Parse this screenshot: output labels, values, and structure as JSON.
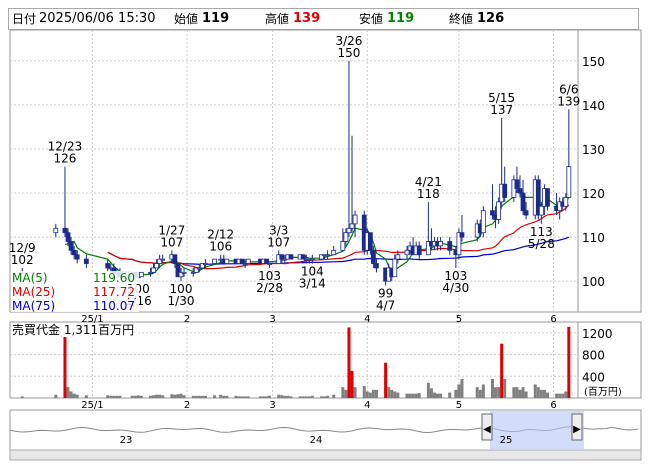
{
  "header": {
    "date_label": "日付",
    "date": "2025/06/06 15:30",
    "open_label": "始値",
    "open": "119",
    "high_label": "高値",
    "high": "139",
    "low_label": "安値",
    "low": "119",
    "close_label": "終値",
    "close": "126"
  },
  "legend": [
    {
      "label": "MA(5)",
      "value": "119.60",
      "color": "#008000"
    },
    {
      "label": "MA(25)",
      "value": "117.72",
      "color": "#e00000"
    },
    {
      "label": "MA(75)",
      "value": "110.07",
      "color": "#0000d0"
    }
  ],
  "volume_label": "売買代金 1,311百万円",
  "volume_unit": "(百万円)",
  "nav_labels": [
    "23",
    "24",
    "25"
  ],
  "colors": {
    "up": "#ffffff",
    "down": "#1a2b8c",
    "ma5": "#008000",
    "ma25": "#e00000",
    "ma75": "#0000d0",
    "vol": "#808080",
    "vol_hi": "#e00000"
  },
  "chart_data": {
    "type": "candlestick",
    "y_ticks": [
      100,
      110,
      120,
      130,
      140,
      150
    ],
    "ylim": [
      93,
      157
    ],
    "vol_ticks": [
      400,
      800,
      1200
    ],
    "vol_lim": [
      0,
      1400
    ],
    "month_labels": [
      {
        "label": "25/1",
        "date": "2025-01-01"
      },
      {
        "label": "2",
        "date": "2025-02-01"
      },
      {
        "label": "3",
        "date": "2025-03-01"
      },
      {
        "label": "4",
        "date": "2025-04-01"
      },
      {
        "label": "5",
        "date": "2025-05-01"
      },
      {
        "label": "6",
        "date": "2025-06-01"
      }
    ],
    "annotations": [
      {
        "date": "2024-12-09",
        "text": "12/9",
        "value": "102",
        "pos": "above"
      },
      {
        "date": "2024-12-23",
        "text": "12/23",
        "value": "126",
        "pos": "above"
      },
      {
        "date": "2025-01-16",
        "text": "1/16",
        "value": "100",
        "pos": "below"
      },
      {
        "date": "2025-01-27",
        "text": "1/27",
        "value": "107",
        "pos": "above"
      },
      {
        "date": "2025-01-30",
        "text": "1/30",
        "value": "100",
        "pos": "below"
      },
      {
        "date": "2025-02-12",
        "text": "2/12",
        "value": "106",
        "pos": "above"
      },
      {
        "date": "2025-02-28",
        "text": "2/28",
        "value": "103",
        "pos": "below"
      },
      {
        "date": "2025-03-03",
        "text": "3/3",
        "value": "107",
        "pos": "above"
      },
      {
        "date": "2025-03-14",
        "text": "3/14",
        "value": "104",
        "pos": "below"
      },
      {
        "date": "2025-03-26",
        "text": "3/26",
        "value": "150",
        "pos": "above"
      },
      {
        "date": "2025-04-07",
        "text": "4/7",
        "value": "99",
        "pos": "below"
      },
      {
        "date": "2025-04-21",
        "text": "4/21",
        "value": "118",
        "pos": "above"
      },
      {
        "date": "2025-04-30",
        "text": "4/30",
        "value": "103",
        "pos": "below"
      },
      {
        "date": "2025-05-15",
        "text": "5/15",
        "value": "137",
        "pos": "above"
      },
      {
        "date": "2025-05-28",
        "text": "5/28",
        "value": "113",
        "pos": "below"
      },
      {
        "date": "2025-06-06",
        "text": "6/6",
        "value": "139",
        "pos": "above"
      }
    ],
    "candles": [
      {
        "d": "2024-12-09",
        "o": 102,
        "h": 103,
        "l": 102,
        "c": 102,
        "v": 30
      },
      {
        "d": "2024-12-20",
        "o": 111,
        "h": 113,
        "l": 110,
        "c": 112,
        "v": 60
      },
      {
        "d": "2024-12-23",
        "o": 112,
        "h": 126,
        "l": 110,
        "c": 111,
        "v": 1250
      },
      {
        "d": "2024-12-24",
        "o": 111,
        "h": 112,
        "l": 108,
        "c": 109,
        "v": 200
      },
      {
        "d": "2024-12-25",
        "o": 109,
        "h": 110,
        "l": 106,
        "c": 107,
        "v": 120
      },
      {
        "d": "2024-12-26",
        "o": 107,
        "h": 108,
        "l": 105,
        "c": 106,
        "v": 80
      },
      {
        "d": "2024-12-27",
        "o": 106,
        "h": 107,
        "l": 104,
        "c": 105,
        "v": 60
      },
      {
        "d": "2024-12-30",
        "o": 105,
        "h": 106,
        "l": 103,
        "c": 104,
        "v": 50
      },
      {
        "d": "2025-01-06",
        "o": 104,
        "h": 105,
        "l": 102,
        "c": 103,
        "v": 50
      },
      {
        "d": "2025-01-07",
        "o": 103,
        "h": 104,
        "l": 102,
        "c": 103,
        "v": 40
      },
      {
        "d": "2025-01-08",
        "o": 103,
        "h": 104,
        "l": 102,
        "c": 102,
        "v": 40
      },
      {
        "d": "2025-01-09",
        "o": 102,
        "h": 103,
        "l": 101,
        "c": 102,
        "v": 40
      },
      {
        "d": "2025-01-10",
        "o": 102,
        "h": 103,
        "l": 101,
        "c": 101,
        "v": 40
      },
      {
        "d": "2025-01-14",
        "o": 101,
        "h": 102,
        "l": 101,
        "c": 102,
        "v": 40
      },
      {
        "d": "2025-01-15",
        "o": 102,
        "h": 102,
        "l": 100,
        "c": 101,
        "v": 40
      },
      {
        "d": "2025-01-16",
        "o": 101,
        "h": 102,
        "l": 100,
        "c": 101,
        "v": 50
      },
      {
        "d": "2025-01-17",
        "o": 101,
        "h": 102,
        "l": 101,
        "c": 102,
        "v": 40
      },
      {
        "d": "2025-01-20",
        "o": 102,
        "h": 103,
        "l": 101,
        "c": 102,
        "v": 40
      },
      {
        "d": "2025-01-21",
        "o": 102,
        "h": 104,
        "l": 102,
        "c": 103,
        "v": 50
      },
      {
        "d": "2025-01-22",
        "o": 103,
        "h": 105,
        "l": 103,
        "c": 104,
        "v": 60
      },
      {
        "d": "2025-01-23",
        "o": 104,
        "h": 106,
        "l": 103,
        "c": 105,
        "v": 60
      },
      {
        "d": "2025-01-24",
        "o": 105,
        "h": 106,
        "l": 104,
        "c": 105,
        "v": 50
      },
      {
        "d": "2025-01-27",
        "o": 105,
        "h": 107,
        "l": 104,
        "c": 106,
        "v": 70
      },
      {
        "d": "2025-01-28",
        "o": 106,
        "h": 106,
        "l": 103,
        "c": 104,
        "v": 60
      },
      {
        "d": "2025-01-29",
        "o": 104,
        "h": 104,
        "l": 101,
        "c": 101,
        "v": 70
      },
      {
        "d": "2025-01-30",
        "o": 101,
        "h": 103,
        "l": 100,
        "c": 102,
        "v": 80
      },
      {
        "d": "2025-01-31",
        "o": 102,
        "h": 103,
        "l": 101,
        "c": 102,
        "v": 50
      },
      {
        "d": "2025-02-03",
        "o": 102,
        "h": 103,
        "l": 101,
        "c": 102,
        "v": 40
      },
      {
        "d": "2025-02-04",
        "o": 102,
        "h": 103,
        "l": 102,
        "c": 103,
        "v": 40
      },
      {
        "d": "2025-02-05",
        "o": 103,
        "h": 104,
        "l": 102,
        "c": 103,
        "v": 40
      },
      {
        "d": "2025-02-06",
        "o": 103,
        "h": 104,
        "l": 103,
        "c": 104,
        "v": 40
      },
      {
        "d": "2025-02-07",
        "o": 104,
        "h": 105,
        "l": 103,
        "c": 104,
        "v": 40
      },
      {
        "d": "2025-02-10",
        "o": 104,
        "h": 105,
        "l": 104,
        "c": 105,
        "v": 50
      },
      {
        "d": "2025-02-12",
        "o": 105,
        "h": 106,
        "l": 104,
        "c": 105,
        "v": 60
      },
      {
        "d": "2025-02-13",
        "o": 105,
        "h": 106,
        "l": 104,
        "c": 104,
        "v": 40
      },
      {
        "d": "2025-02-14",
        "o": 104,
        "h": 105,
        "l": 104,
        "c": 105,
        "v": 40
      },
      {
        "d": "2025-02-17",
        "o": 105,
        "h": 105,
        "l": 104,
        "c": 104,
        "v": 40
      },
      {
        "d": "2025-02-18",
        "o": 104,
        "h": 105,
        "l": 104,
        "c": 105,
        "v": 30
      },
      {
        "d": "2025-02-19",
        "o": 105,
        "h": 105,
        "l": 104,
        "c": 104,
        "v": 30
      },
      {
        "d": "2025-02-20",
        "o": 104,
        "h": 105,
        "l": 103,
        "c": 104,
        "v": 30
      },
      {
        "d": "2025-02-21",
        "o": 104,
        "h": 105,
        "l": 104,
        "c": 105,
        "v": 30
      },
      {
        "d": "2025-02-25",
        "o": 105,
        "h": 105,
        "l": 104,
        "c": 104,
        "v": 30
      },
      {
        "d": "2025-02-26",
        "o": 104,
        "h": 105,
        "l": 104,
        "c": 105,
        "v": 30
      },
      {
        "d": "2025-02-27",
        "o": 105,
        "h": 105,
        "l": 104,
        "c": 104,
        "v": 30
      },
      {
        "d": "2025-02-28",
        "o": 104,
        "h": 104,
        "l": 103,
        "c": 104,
        "v": 40
      },
      {
        "d": "2025-03-03",
        "o": 104,
        "h": 107,
        "l": 104,
        "c": 106,
        "v": 60
      },
      {
        "d": "2025-03-04",
        "o": 106,
        "h": 106,
        "l": 104,
        "c": 105,
        "v": 50
      },
      {
        "d": "2025-03-05",
        "o": 105,
        "h": 106,
        "l": 104,
        "c": 105,
        "v": 40
      },
      {
        "d": "2025-03-06",
        "o": 105,
        "h": 106,
        "l": 105,
        "c": 106,
        "v": 40
      },
      {
        "d": "2025-03-07",
        "o": 106,
        "h": 106,
        "l": 105,
        "c": 105,
        "v": 30
      },
      {
        "d": "2025-03-10",
        "o": 105,
        "h": 106,
        "l": 105,
        "c": 106,
        "v": 30
      },
      {
        "d": "2025-03-11",
        "o": 106,
        "h": 106,
        "l": 105,
        "c": 105,
        "v": 30
      },
      {
        "d": "2025-03-12",
        "o": 105,
        "h": 106,
        "l": 104,
        "c": 105,
        "v": 30
      },
      {
        "d": "2025-03-13",
        "o": 105,
        "h": 105,
        "l": 104,
        "c": 105,
        "v": 30
      },
      {
        "d": "2025-03-14",
        "o": 105,
        "h": 106,
        "l": 104,
        "c": 105,
        "v": 40
      },
      {
        "d": "2025-03-17",
        "o": 105,
        "h": 106,
        "l": 105,
        "c": 106,
        "v": 30
      },
      {
        "d": "2025-03-18",
        "o": 106,
        "h": 106,
        "l": 105,
        "c": 106,
        "v": 30
      },
      {
        "d": "2025-03-19",
        "o": 106,
        "h": 107,
        "l": 105,
        "c": 106,
        "v": 40
      },
      {
        "d": "2025-03-21",
        "o": 106,
        "h": 108,
        "l": 106,
        "c": 107,
        "v": 60
      },
      {
        "d": "2025-03-24",
        "o": 107,
        "h": 112,
        "l": 107,
        "c": 109,
        "v": 200
      },
      {
        "d": "2025-03-25",
        "o": 109,
        "h": 112,
        "l": 108,
        "c": 111,
        "v": 150
      },
      {
        "d": "2025-03-26",
        "o": 111,
        "h": 150,
        "l": 110,
        "c": 112,
        "v": 1300
      },
      {
        "d": "2025-03-27",
        "o": 112,
        "h": 133,
        "l": 111,
        "c": 113,
        "v": 500
      },
      {
        "d": "2025-03-28",
        "o": 113,
        "h": 116,
        "l": 110,
        "c": 115,
        "v": 200
      },
      {
        "d": "2025-03-31",
        "o": 115,
        "h": 116,
        "l": 106,
        "c": 107,
        "v": 220
      },
      {
        "d": "2025-04-01",
        "o": 107,
        "h": 112,
        "l": 106,
        "c": 111,
        "v": 120
      },
      {
        "d": "2025-04-02",
        "o": 111,
        "h": 111,
        "l": 106,
        "c": 107,
        "v": 100
      },
      {
        "d": "2025-04-03",
        "o": 107,
        "h": 108,
        "l": 103,
        "c": 104,
        "v": 150
      },
      {
        "d": "2025-04-04",
        "o": 104,
        "h": 105,
        "l": 102,
        "c": 103,
        "v": 150
      },
      {
        "d": "2025-04-07",
        "o": 103,
        "h": 103,
        "l": 99,
        "c": 100,
        "v": 650
      },
      {
        "d": "2025-04-08",
        "o": 100,
        "h": 104,
        "l": 100,
        "c": 103,
        "v": 200
      },
      {
        "d": "2025-04-09",
        "o": 103,
        "h": 103,
        "l": 100,
        "c": 101,
        "v": 150
      },
      {
        "d": "2025-04-10",
        "o": 101,
        "h": 106,
        "l": 101,
        "c": 105,
        "v": 120
      },
      {
        "d": "2025-04-11",
        "o": 105,
        "h": 107,
        "l": 104,
        "c": 106,
        "v": 100
      },
      {
        "d": "2025-04-14",
        "o": 106,
        "h": 108,
        "l": 105,
        "c": 107,
        "v": 80
      },
      {
        "d": "2025-04-15",
        "o": 107,
        "h": 109,
        "l": 106,
        "c": 108,
        "v": 80
      },
      {
        "d": "2025-04-16",
        "o": 108,
        "h": 110,
        "l": 106,
        "c": 106,
        "v": 80
      },
      {
        "d": "2025-04-17",
        "o": 106,
        "h": 109,
        "l": 106,
        "c": 108,
        "v": 80
      },
      {
        "d": "2025-04-18",
        "o": 108,
        "h": 109,
        "l": 105,
        "c": 106,
        "v": 90
      },
      {
        "d": "2025-04-21",
        "o": 106,
        "h": 118,
        "l": 106,
        "c": 109,
        "v": 280
      },
      {
        "d": "2025-04-22",
        "o": 109,
        "h": 112,
        "l": 107,
        "c": 108,
        "v": 180
      },
      {
        "d": "2025-04-23",
        "o": 108,
        "h": 110,
        "l": 107,
        "c": 109,
        "v": 100
      },
      {
        "d": "2025-04-24",
        "o": 109,
        "h": 110,
        "l": 107,
        "c": 108,
        "v": 80
      },
      {
        "d": "2025-04-25",
        "o": 108,
        "h": 110,
        "l": 107,
        "c": 109,
        "v": 80
      },
      {
        "d": "2025-04-28",
        "o": 109,
        "h": 110,
        "l": 106,
        "c": 107,
        "v": 100
      },
      {
        "d": "2025-04-30",
        "o": 107,
        "h": 108,
        "l": 103,
        "c": 106,
        "v": 150
      },
      {
        "d": "2025-05-01",
        "o": 106,
        "h": 112,
        "l": 105,
        "c": 111,
        "v": 250
      },
      {
        "d": "2025-05-02",
        "o": 111,
        "h": 115,
        "l": 109,
        "c": 110,
        "v": 350
      },
      {
        "d": "2025-05-07",
        "o": 110,
        "h": 114,
        "l": 109,
        "c": 113,
        "v": 200
      },
      {
        "d": "2025-05-08",
        "o": 113,
        "h": 114,
        "l": 110,
        "c": 111,
        "v": 150
      },
      {
        "d": "2025-05-09",
        "o": 111,
        "h": 117,
        "l": 110,
        "c": 116,
        "v": 250
      },
      {
        "d": "2025-05-12",
        "o": 116,
        "h": 122,
        "l": 114,
        "c": 115,
        "v": 350
      },
      {
        "d": "2025-05-13",
        "o": 115,
        "h": 117,
        "l": 112,
        "c": 114,
        "v": 200
      },
      {
        "d": "2025-05-14",
        "o": 114,
        "h": 119,
        "l": 113,
        "c": 118,
        "v": 200
      },
      {
        "d": "2025-05-15",
        "o": 118,
        "h": 137,
        "l": 117,
        "c": 122,
        "v": 1000
      },
      {
        "d": "2025-05-16",
        "o": 122,
        "h": 126,
        "l": 118,
        "c": 119,
        "v": 350
      },
      {
        "d": "2025-05-19",
        "o": 119,
        "h": 124,
        "l": 118,
        "c": 123,
        "v": 200
      },
      {
        "d": "2025-05-20",
        "o": 123,
        "h": 126,
        "l": 120,
        "c": 121,
        "v": 200
      },
      {
        "d": "2025-05-21",
        "o": 121,
        "h": 124,
        "l": 119,
        "c": 120,
        "v": 150
      },
      {
        "d": "2025-05-22",
        "o": 120,
        "h": 123,
        "l": 115,
        "c": 116,
        "v": 200
      },
      {
        "d": "2025-05-23",
        "o": 116,
        "h": 118,
        "l": 114,
        "c": 115,
        "v": 120
      },
      {
        "d": "2025-05-26",
        "o": 115,
        "h": 124,
        "l": 114,
        "c": 123,
        "v": 250
      },
      {
        "d": "2025-05-27",
        "o": 123,
        "h": 124,
        "l": 114,
        "c": 115,
        "v": 200
      },
      {
        "d": "2025-05-28",
        "o": 115,
        "h": 118,
        "l": 113,
        "c": 117,
        "v": 150
      },
      {
        "d": "2025-05-29",
        "o": 117,
        "h": 122,
        "l": 115,
        "c": 121,
        "v": 150
      },
      {
        "d": "2025-05-30",
        "o": 121,
        "h": 121,
        "l": 116,
        "c": 117,
        "v": 100
      },
      {
        "d": "2025-06-02",
        "o": 117,
        "h": 120,
        "l": 115,
        "c": 116,
        "v": 80
      },
      {
        "d": "2025-06-03",
        "o": 116,
        "h": 119,
        "l": 114,
        "c": 118,
        "v": 80
      },
      {
        "d": "2025-06-04",
        "o": 118,
        "h": 119,
        "l": 116,
        "c": 117,
        "v": 80
      },
      {
        "d": "2025-06-05",
        "o": 117,
        "h": 120,
        "l": 116,
        "c": 119,
        "v": 120
      },
      {
        "d": "2025-06-06",
        "o": 119,
        "h": 139,
        "l": 119,
        "c": 126,
        "v": 1311
      }
    ]
  }
}
